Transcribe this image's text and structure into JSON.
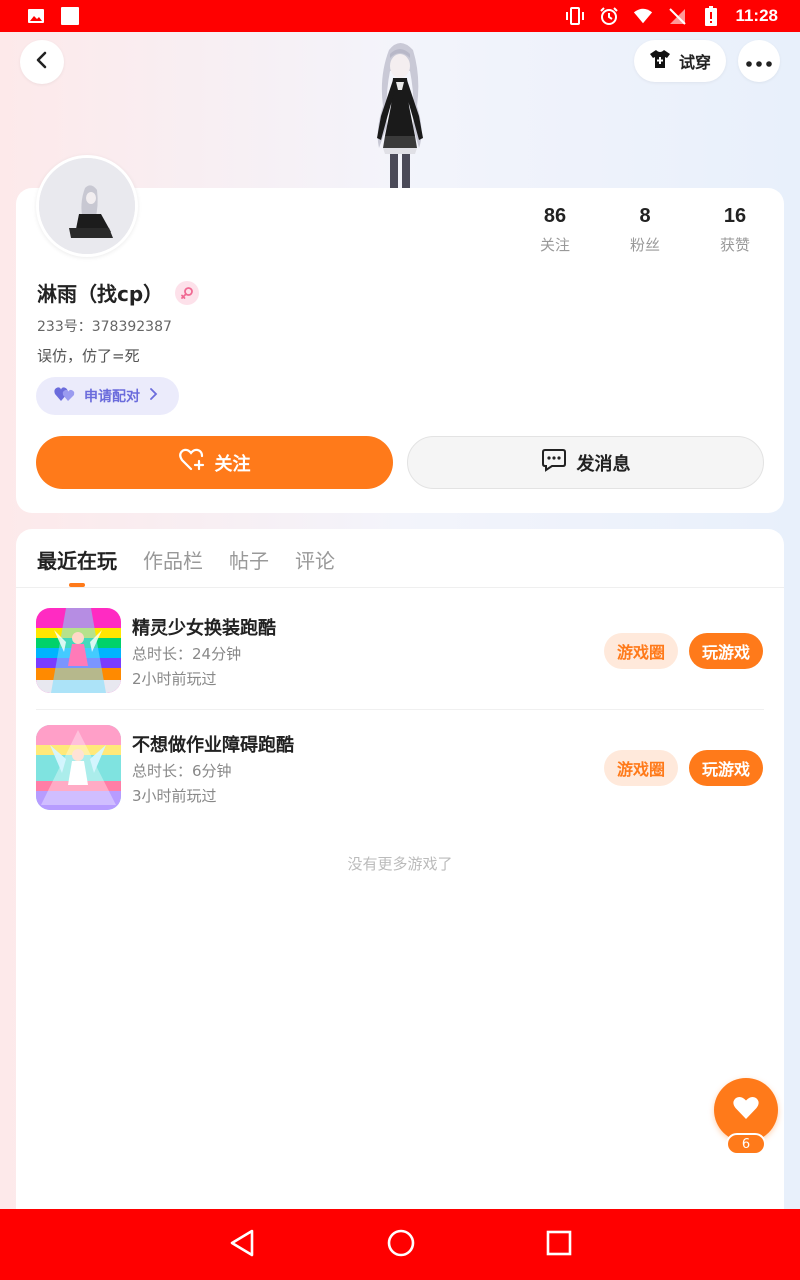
{
  "status_bar": {
    "time": "11:28",
    "icons": [
      "image-icon",
      "square-icon",
      "vibrate-icon",
      "alarm-icon",
      "wifi-icon",
      "no-sim-icon",
      "battery-icon"
    ],
    "color": "#ff0000"
  },
  "header": {
    "try_on_label": "试穿",
    "icons": [
      "back-icon",
      "shirt-icon",
      "more-icon"
    ]
  },
  "profile": {
    "username": "淋雨（找cp）",
    "user_id": "233号：378392387",
    "bio": "误仿，仿了=死",
    "pair_label": "申请配对",
    "stats": [
      {
        "value": "86",
        "label": "关注"
      },
      {
        "value": "8",
        "label": "粉丝"
      },
      {
        "value": "16",
        "label": "获赞"
      }
    ],
    "follow_label": "关注",
    "message_label": "发消息"
  },
  "tabs": [
    {
      "label": "最近在玩",
      "active": true
    },
    {
      "label": "作品栏",
      "active": false
    },
    {
      "label": "帖子",
      "active": false
    },
    {
      "label": "评论",
      "active": false
    }
  ],
  "games": [
    {
      "title": "精灵少女换装跑酷",
      "duration": "总时长：24分钟",
      "last_played": "2小时前玩过",
      "circle_label": "游戏圈",
      "play_label": "玩游戏"
    },
    {
      "title": "不想做作业障碍跑酷",
      "duration": "总时长：6分钟",
      "last_played": "3小时前玩过",
      "circle_label": "游戏圈",
      "play_label": "玩游戏"
    }
  ],
  "no_more_text": "没有更多游戏了",
  "like": {
    "count": "6"
  },
  "colors": {
    "accent": "#ff7a1a",
    "pair": "#6b6cdc",
    "system_bar": "#ff0000"
  }
}
